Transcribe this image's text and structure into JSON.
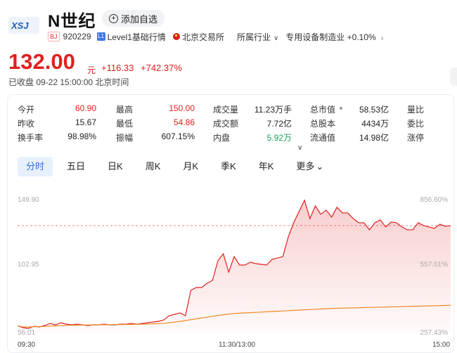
{
  "header": {
    "logo_text": "XSJ",
    "stock_name": "N世纪",
    "add_watch_label": "添加自选",
    "exchange_badge": "BJ",
    "stock_code": "920229",
    "level_badge": "L1",
    "level_text": "Level1基础行情",
    "exchange_name": "北京交易所",
    "industry_label": "所属行业",
    "industry_name": "专用设备制造业",
    "industry_change": "+0.10%"
  },
  "quote": {
    "price": "132.00",
    "unit": "元",
    "change": "+116.33",
    "change_pct": "+742.37%",
    "status": "已收盘  09-22 15:00:00  北京时间"
  },
  "stats": {
    "rows": [
      [
        {
          "label": "今开",
          "value": "60.90",
          "tone": "red"
        },
        {
          "label": "最高",
          "value": "150.00",
          "tone": "red"
        },
        {
          "label": "成交量",
          "value": "11.23万手",
          "tone": "dark"
        },
        {
          "label": "总市值",
          "value": "58.53亿",
          "tone": "dark",
          "has_arrow": true
        },
        {
          "label": "量比",
          "value": "",
          "tone": "dark"
        }
      ],
      [
        {
          "label": "昨收",
          "value": "15.67",
          "tone": "dark"
        },
        {
          "label": "最低",
          "value": "54.86",
          "tone": "red"
        },
        {
          "label": "成交额",
          "value": "7.72亿",
          "tone": "dark"
        },
        {
          "label": "总股本",
          "value": "4434万",
          "tone": "dark"
        },
        {
          "label": "委比",
          "value": "",
          "tone": "dark"
        }
      ],
      [
        {
          "label": "换手率",
          "value": "98.98%",
          "tone": "dark"
        },
        {
          "label": "振幅",
          "value": "607.15%",
          "tone": "dark"
        },
        {
          "label": "内盘",
          "value": "5.92万",
          "tone": "green"
        },
        {
          "label": "流通值",
          "value": "14.98亿",
          "tone": "dark"
        },
        {
          "label": "涨停",
          "value": "",
          "tone": "dark"
        }
      ]
    ]
  },
  "tabs": [
    {
      "label": "分时",
      "active": true
    },
    {
      "label": "五日",
      "active": false
    },
    {
      "label": "日K",
      "active": false
    },
    {
      "label": "周K",
      "active": false
    },
    {
      "label": "月K",
      "active": false
    },
    {
      "label": "季K",
      "active": false
    },
    {
      "label": "年K",
      "active": false
    },
    {
      "label": "更多",
      "active": false,
      "has_arrow": true
    }
  ],
  "colors": {
    "up": "#e02020",
    "down": "#18a058",
    "avg_line": "#f08a24",
    "tab_active": "#2f6fe0"
  },
  "chart_data": {
    "type": "line",
    "y_left_labels": [
      "149.90",
      "102.95",
      "56.01"
    ],
    "y_right_labels": [
      "856.60%",
      "557.01%",
      "257.43%"
    ],
    "x_labels": [
      "09:30",
      "11:30/13:00",
      "15:00"
    ],
    "ylim": [
      56.01,
      149.9
    ],
    "x": [
      0,
      3,
      6,
      9,
      12,
      15,
      18,
      21,
      24,
      27,
      30,
      33,
      36,
      39,
      42,
      45,
      48,
      51,
      54,
      57,
      60,
      63,
      66,
      69,
      72,
      75,
      78,
      81,
      84,
      87,
      90,
      93,
      96,
      99,
      102,
      105,
      108,
      111,
      114,
      117,
      120,
      123,
      126,
      129,
      132,
      135,
      138,
      141,
      144,
      147,
      150,
      153,
      156,
      159,
      162,
      165,
      168,
      171,
      174,
      177,
      180,
      183,
      186,
      189,
      192,
      195,
      198,
      201,
      204,
      207,
      210,
      213,
      216,
      219,
      222,
      225,
      228,
      231,
      234,
      237,
      240
    ],
    "series": [
      {
        "values": [
          60.9,
          59.5,
          59.0,
          60.5,
          60.0,
          61.0,
          62.5,
          61.5,
          63.0,
          62.0,
          61.5,
          62.0,
          61.5,
          61.0,
          61.5,
          61.5,
          62.0,
          61.5,
          61.5,
          62.0,
          62.0,
          62.5,
          62.0,
          62.5,
          63.0,
          63.5,
          64.0,
          65.0,
          68.0,
          69.0,
          70.0,
          68.0,
          86.0,
          88.0,
          88.0,
          91.0,
          93.0,
          107.0,
          112.0,
          99.0,
          110.0,
          104.0,
          104.0,
          106.0,
          105.0,
          104.5,
          104.0,
          108.0,
          109.0,
          110.0,
          124.0,
          134.0,
          142.0,
          150.0,
          137.0,
          146.0,
          140.0,
          143.0,
          138.0,
          145.0,
          141.0,
          141.0,
          137.0,
          134.0,
          134.0,
          129.0,
          134.0,
          136.0,
          131.0,
          134.5,
          134.0,
          131.0,
          129.0,
          129.0,
          134.0,
          132.0,
          131.0,
          130.0,
          133.0,
          131.5,
          132.0
        ]
      },
      {
        "values": [
          60.9,
          60.0,
          60.0,
          60.2,
          60.3,
          60.4,
          60.6,
          60.8,
          61.0,
          61.1,
          61.2,
          61.3,
          61.4,
          61.4,
          61.5,
          61.5,
          61.6,
          61.6,
          61.7,
          61.7,
          61.8,
          61.8,
          61.9,
          62.0,
          62.1,
          62.2,
          62.4,
          62.6,
          63.0,
          63.5,
          64.0,
          64.6,
          65.2,
          65.8,
          66.4,
          67.0,
          67.6,
          68.2,
          68.7,
          69.2,
          69.6,
          69.8,
          70.0,
          70.2,
          70.4,
          70.6,
          70.8,
          71.0,
          71.2,
          71.4,
          71.6,
          71.8,
          72.0,
          72.2,
          72.4,
          72.6,
          72.8,
          73.0,
          73.2,
          73.3,
          73.4,
          73.5,
          73.6,
          73.7,
          73.8,
          73.9,
          74.0,
          74.1,
          74.2,
          74.3,
          74.4,
          74.5,
          74.6,
          74.7,
          74.8,
          74.9,
          75.0,
          75.1,
          75.2,
          75.3,
          75.4
        ]
      }
    ],
    "reference_line": 132.0,
    "grid": false
  }
}
